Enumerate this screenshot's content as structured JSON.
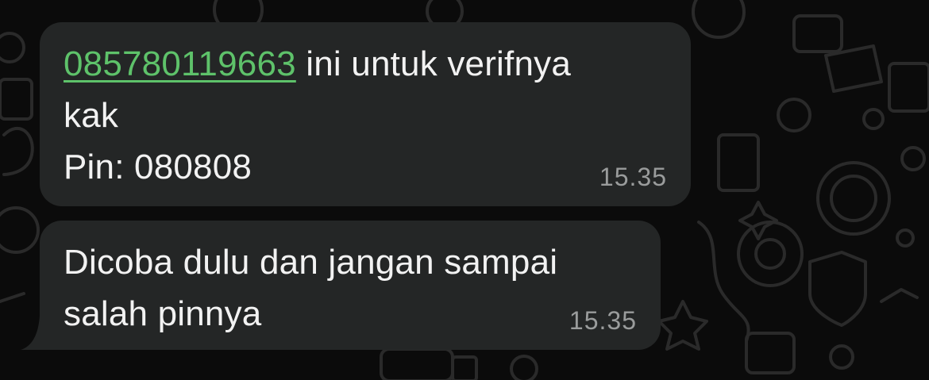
{
  "messages": [
    {
      "link": "085780119663",
      "lines": [
        " ini untuk verifnya",
        "kak",
        "Pin: 080808"
      ],
      "time": "15.35"
    },
    {
      "lines": [
        "Dicoba dulu dan jangan sampai",
        "salah pinnya"
      ],
      "time": "15.35"
    }
  ],
  "colors": {
    "background": "#0b0b0b",
    "bubble": "#242626",
    "link": "#5ec26a",
    "text": "#f2f2f2",
    "timestamp": "#9a9c9c"
  }
}
